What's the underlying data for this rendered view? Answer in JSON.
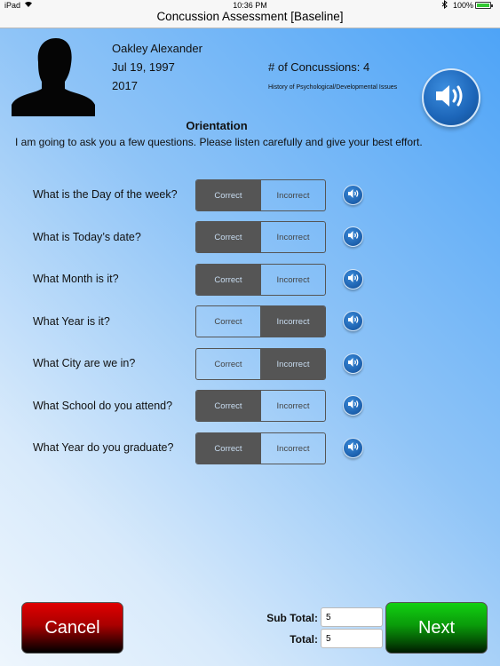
{
  "status_bar": {
    "carrier": "iPad",
    "time": "10:36 PM",
    "battery": "100%"
  },
  "nav": {
    "title": "Concussion Assessment [Baseline]"
  },
  "athlete": {
    "name": "Oakley Alexander",
    "dob": "Jul 19, 1997",
    "year": "2017",
    "concussions": "# of Concussions: 4",
    "history": "History of Psychological/Developmental Issues"
  },
  "section": {
    "title": "Orientation",
    "instructions": "I am going to ask you a few questions. Please listen carefully and give your best effort."
  },
  "options": {
    "correct": "Correct",
    "incorrect": "Incorrect"
  },
  "questions": [
    {
      "label": "What is the Day of the week?",
      "selected": "correct"
    },
    {
      "label": "What is Today’s date?",
      "selected": "correct"
    },
    {
      "label": "What Month is it?",
      "selected": "correct"
    },
    {
      "label": "What Year is it?",
      "selected": "incorrect"
    },
    {
      "label": "What City are we in?",
      "selected": "incorrect"
    },
    {
      "label": "What School do you attend?",
      "selected": "correct"
    },
    {
      "label": "What Year do you graduate?",
      "selected": "correct"
    }
  ],
  "footer": {
    "cancel_label": "Cancel",
    "next_label": "Next",
    "subtotal_label": "Sub Total:",
    "subtotal_value": "5",
    "total_label": "Total:",
    "total_value": "5"
  },
  "colors": {
    "selected_segment": "#555555",
    "cancel": "#cc0000",
    "next": "#0bb00b",
    "speaker": "#1c65b8"
  },
  "icons": {
    "wifi": "wifi-icon",
    "bluetooth": "bluetooth-icon",
    "speaker": "speaker-icon"
  }
}
